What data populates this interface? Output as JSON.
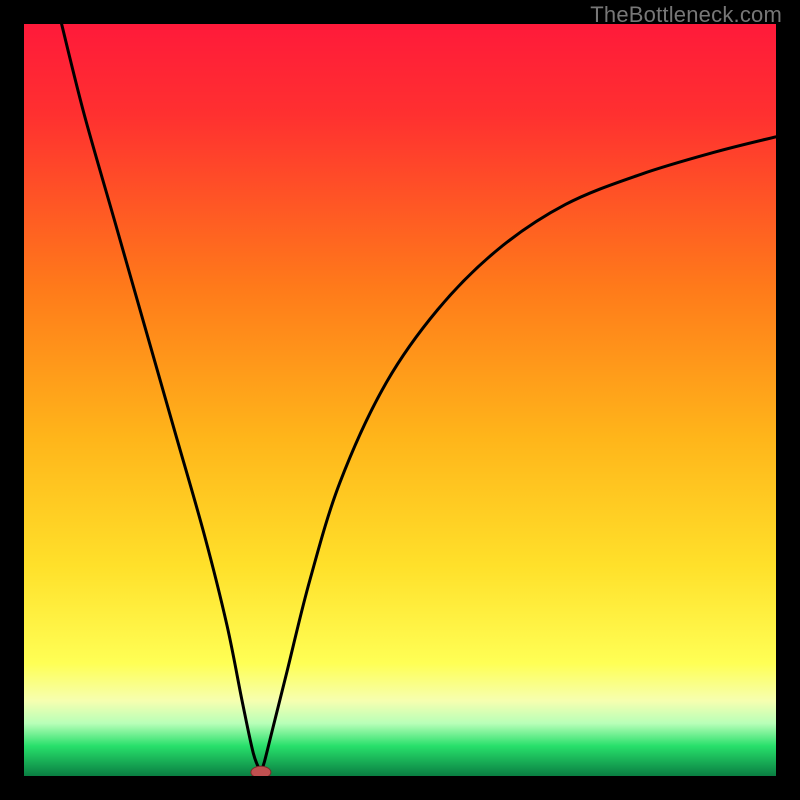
{
  "watermark": "TheBottleneck.com",
  "chart_data": {
    "type": "line",
    "title": "",
    "xlabel": "",
    "ylabel": "",
    "xlim": [
      0,
      100
    ],
    "ylim": [
      0,
      100
    ],
    "background_gradient": {
      "top_color": "#ff1a3a",
      "mid_color": "#ffc82a",
      "green_band_color": "#28e06b",
      "bottom_edge_color": "#0a7e42"
    },
    "curve_description": "Two arcs descending from high on left and right meeting in a sharp cusp near x≈31, y≈0; asymmetric V-shape",
    "series": [
      {
        "name": "curve",
        "x": [
          5,
          8,
          12,
          16,
          20,
          24,
          27,
          29,
          30.5,
          31.5,
          32,
          33,
          35,
          38,
          42,
          48,
          55,
          63,
          72,
          82,
          92,
          100
        ],
        "y": [
          100,
          88,
          74,
          60,
          46,
          32,
          20,
          10,
          3,
          0.5,
          2,
          6,
          14,
          26,
          39,
          52,
          62,
          70,
          76,
          80,
          83,
          85
        ]
      }
    ],
    "cusp_marker": {
      "x": 31.5,
      "y": 0.5,
      "color": "#c05050"
    }
  }
}
